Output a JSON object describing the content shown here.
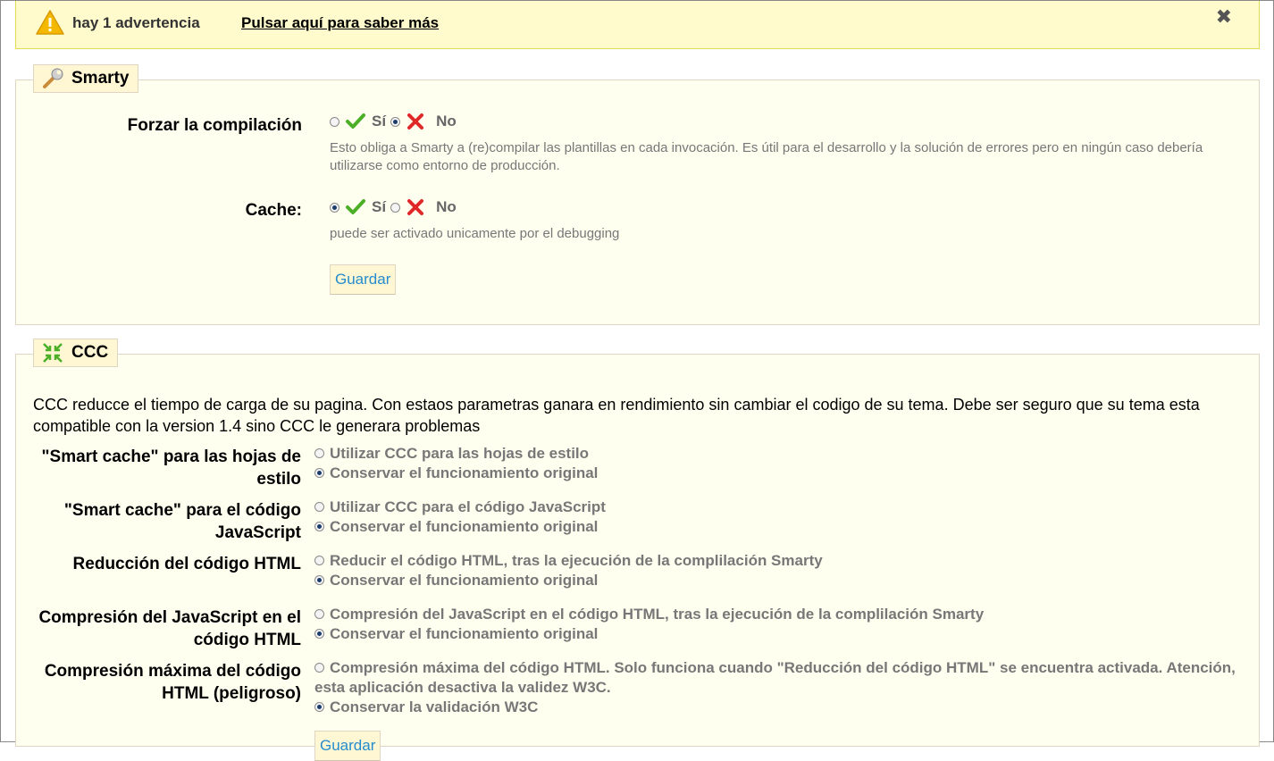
{
  "warning": {
    "text": "hay 1 advertencia",
    "link": "Pulsar aquí para saber más",
    "close": "✖"
  },
  "smarty": {
    "title": "Smarty",
    "force_compile": {
      "label": "Forzar la compilación",
      "yes": "Sí",
      "no": "No",
      "selected": "no",
      "help": "Esto obliga a Smarty a (re)compilar las plantillas en cada invocación. Es útil para el desarrollo y la solución de errores pero en ningún caso debería utilizarse como entorno de producción."
    },
    "cache": {
      "label": "Cache:",
      "yes": "Sí",
      "no": "No",
      "selected": "yes",
      "help": "puede ser activado unicamente por el debugging"
    },
    "save": "Guardar"
  },
  "ccc": {
    "title": "CCC",
    "intro": "CCC reducce el tiempo de carga de su pagina. Con estaos parametras ganara en rendimiento sin cambiar el codigo de su tema. Debe ser seguro que su tema esta compatible con la version 1.4 sino CCC le generara problemas",
    "rows": [
      {
        "label": "\"Smart cache\" para las hojas de estilo",
        "options": [
          "Utilizar CCC para las hojas de estilo",
          "Conservar el funcionamiento original"
        ],
        "selected": 1
      },
      {
        "label": "\"Smart cache\" para el código JavaScript",
        "options": [
          "Utilizar CCC para el código JavaScript",
          "Conservar el funcionamiento original"
        ],
        "selected": 1
      },
      {
        "label": "Reducción del código HTML",
        "options": [
          "Reducir el código HTML, tras la ejecución de la complilación Smarty",
          "Conservar el funcionamiento original"
        ],
        "selected": 1
      },
      {
        "label": "Compresión del JavaScript en el código HTML",
        "options": [
          "Compresión del JavaScript en el código HTML, tras la ejecución de la complilación Smarty",
          "Conservar el funcionamiento original"
        ],
        "selected": 1
      },
      {
        "label": "Compresión máxima del código HTML (peligroso)",
        "options": [
          "Compresión máxima del código HTML. Solo funciona cuando \"Reducción del código HTML\" se encuentra activada. Atención, esta aplicación desactiva la validez W3C.",
          "Conservar la validación W3C"
        ],
        "selected": 1
      }
    ],
    "save": "Guardar"
  },
  "colors": {
    "warning_bg": "#fffbcc",
    "panel_bg": "#fffff0",
    "legend_bg": "#fff6d3",
    "link_blue": "#268ccd",
    "check_green": "#4caf28",
    "cross_red": "#e02828"
  },
  "icons": {
    "warning": "warning-triangle-icon",
    "smarty": "wrench-icon",
    "ccc": "compress-arrows-icon",
    "yes": "check-icon",
    "no": "cross-icon"
  }
}
